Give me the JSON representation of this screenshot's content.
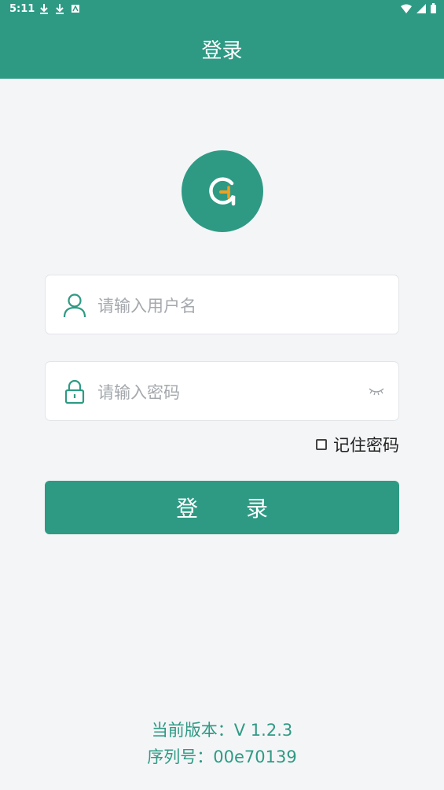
{
  "status_bar": {
    "time": "5:11",
    "left_icons": [
      "download-icon",
      "download-icon",
      "text-icon"
    ],
    "right_icons": [
      "wifi-icon",
      "signal-icon",
      "battery-icon"
    ]
  },
  "header": {
    "title": "登录"
  },
  "logo": {
    "icon": "app-logo-icon",
    "brand_color": "#2e9a84",
    "accent_color": "#f0a020"
  },
  "form": {
    "username": {
      "placeholder": "请输入用户名",
      "value": "",
      "icon": "user-icon"
    },
    "password": {
      "placeholder": "请输入密码",
      "value": "",
      "icon": "lock-icon",
      "toggle_icon": "eye-closed-icon"
    },
    "remember": {
      "label": "记住密码",
      "checked": false
    },
    "submit_label": "登 录"
  },
  "footer": {
    "version_label": "当前版本：",
    "version_value": "V 1.2.3",
    "serial_label": "序列号：",
    "serial_value": "00e70139"
  }
}
